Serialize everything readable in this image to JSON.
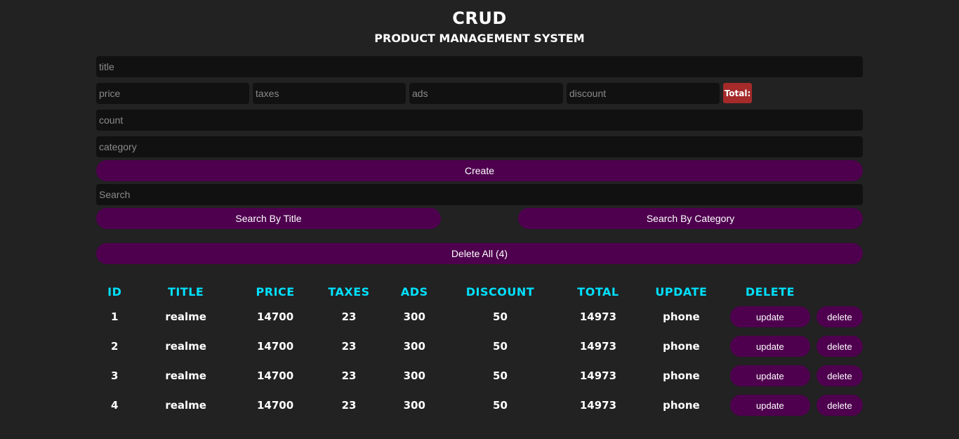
{
  "header": {
    "title": "CRUD",
    "subtitle": "PRODUCT MANAGEMENT SYSTEM"
  },
  "form": {
    "title_placeholder": "title",
    "price_placeholder": "price",
    "taxes_placeholder": "taxes",
    "ads_placeholder": "ads",
    "discount_placeholder": "discount",
    "total_label": "Total:",
    "count_placeholder": "count",
    "category_placeholder": "category",
    "create_label": "Create"
  },
  "search": {
    "placeholder": "Search",
    "by_title_label": "Search By Title",
    "by_category_label": "Search By Category"
  },
  "delete_all_label": "Delete All (4)",
  "table": {
    "headers": [
      "ID",
      "TITLE",
      "PRICE",
      "TAXES",
      "ADS",
      "DISCOUNT",
      "TOTAL",
      "UPDATE",
      "DELETE"
    ],
    "rows": [
      {
        "id": "1",
        "title": "realme",
        "price": "14700",
        "taxes": "23",
        "ads": "300",
        "discount": "50",
        "total": "14973",
        "category": "phone",
        "update": "update",
        "delete": "delete"
      },
      {
        "id": "2",
        "title": "realme",
        "price": "14700",
        "taxes": "23",
        "ads": "300",
        "discount": "50",
        "total": "14973",
        "category": "phone",
        "update": "update",
        "delete": "delete"
      },
      {
        "id": "3",
        "title": "realme",
        "price": "14700",
        "taxes": "23",
        "ads": "300",
        "discount": "50",
        "total": "14973",
        "category": "phone",
        "update": "update",
        "delete": "delete"
      },
      {
        "id": "4",
        "title": "realme",
        "price": "14700",
        "taxes": "23",
        "ads": "300",
        "discount": "50",
        "total": "14973",
        "category": "phone",
        "update": "update",
        "delete": "delete"
      }
    ]
  },
  "colors": {
    "background": "#222222",
    "input_bg": "#111111",
    "button_bg": "#4e004e",
    "total_bg": "#a52a2a",
    "header_cyan": "#00e0ff"
  }
}
